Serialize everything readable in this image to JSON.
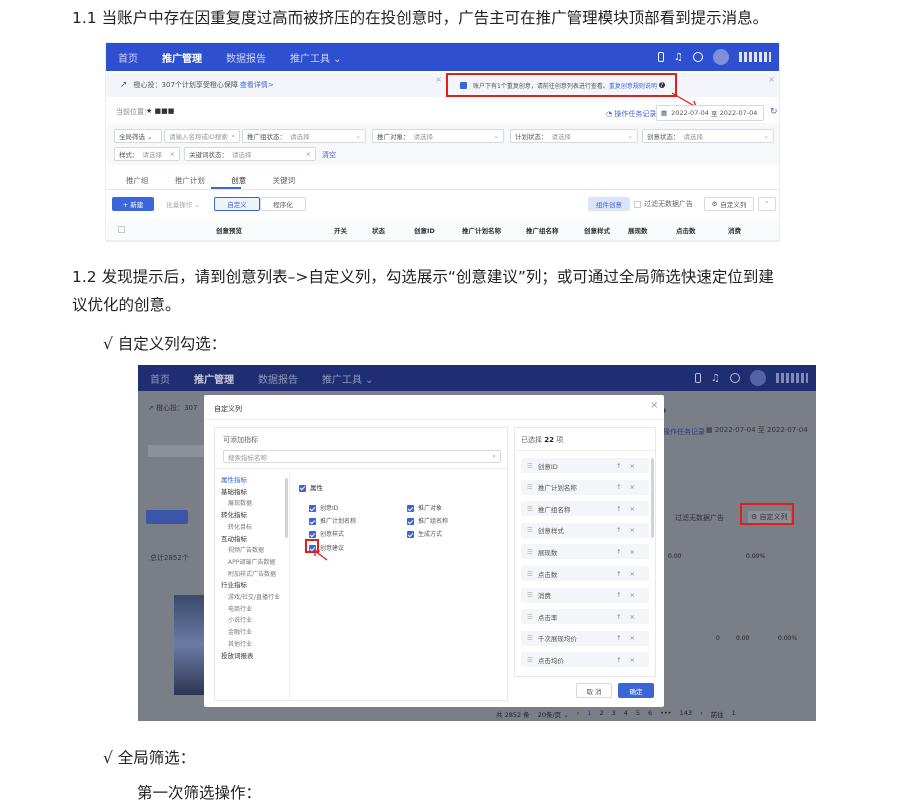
{
  "doc": {
    "para1": "1.1 当账户中存在因重复度过高而被挤压的在投创意时，广告主可在推广管理模块顶部看到提示消息。",
    "para2_line1": "1.2 发现提示后，请到创意列表–>自定义列，勾选展示“创意建议”列；或可通过全局筛选快速定位到建",
    "para2_line2": "议优化的创意。",
    "bullet1": "√ 自定义列勾选：",
    "bullet2": "√ 全局筛选：",
    "sub1": "第一次筛选操作："
  },
  "shot1": {
    "nav": [
      "首页",
      "推广管理",
      "数据报告",
      "推广工具 ⌄"
    ],
    "notice_left": "橙心投：307个计划享受橙心保障",
    "notice_left_link": "查看详情>",
    "notice_right": "账户下有1个重复创意，请前往创意列表进行查看。",
    "notice_right_link": "重复创意规则说明",
    "location_label": "当前位置：",
    "location_value": "★ ■■■",
    "ops_record": "操作任务记录",
    "date_from": "2022-07-04",
    "date_sep": "至",
    "date_to": "2022-07-04",
    "filter_global": "全局筛选 ⌄",
    "filter_search_ph": "请输入名称或ID搜索",
    "filters": [
      {
        "label": "推广组状态：",
        "ph": "请选择"
      },
      {
        "label": "推广对象：",
        "ph": "请选择"
      },
      {
        "label": "计划状态：",
        "ph": "请选择"
      },
      {
        "label": "创意状态：",
        "ph": "请选择"
      },
      {
        "label": "样式：",
        "ph": "请选择"
      },
      {
        "label": "关键词状态：",
        "ph": "请选择"
      }
    ],
    "clear": "清空",
    "tabs": [
      "推广组",
      "推广计划",
      "创意",
      "关键词"
    ],
    "btn_new": "+ 新建",
    "btn_batch": "批量操作 ⌄",
    "btn_custom": "自定义",
    "btn_program": "程序化",
    "btn_component": "组件创意",
    "filter_nodata": "过滤无数据广告",
    "btn_custom_col": "自定义列",
    "columns": [
      "创意预览",
      "开关",
      "状态",
      "创意ID",
      "推广计划名称",
      "推广组名称",
      "创意样式",
      "展现数",
      "点击数",
      "消费"
    ]
  },
  "shot2": {
    "nav": [
      "首页",
      "推广管理",
      "数据报告",
      "推广工具 ⌄"
    ],
    "modal_title": "自定义列",
    "left_header": "可添加指标",
    "search_ph": "搜索指标名称",
    "categories": [
      {
        "text": "属性指标",
        "type": "cat-active"
      },
      {
        "text": "基础指标",
        "type": "cat"
      },
      {
        "text": "展现数据",
        "type": "sub"
      },
      {
        "text": "转化指标",
        "type": "cat"
      },
      {
        "text": "转化目标",
        "type": "sub"
      },
      {
        "text": "互动指标",
        "type": "cat"
      },
      {
        "text": "视频广告数据",
        "type": "sub"
      },
      {
        "text": "APP调端广告数据",
        "type": "sub"
      },
      {
        "text": "附加样式广告数据",
        "type": "sub"
      },
      {
        "text": "行业指标",
        "type": "cat"
      },
      {
        "text": "游戏/社交/直播行业",
        "type": "sub"
      },
      {
        "text": "电商行业",
        "type": "sub"
      },
      {
        "text": "小说行业",
        "type": "sub"
      },
      {
        "text": "金融行业",
        "type": "sub"
      },
      {
        "text": "其他行业",
        "type": "sub"
      },
      {
        "text": "投放词报表",
        "type": "cat"
      }
    ],
    "attr_group": "属性",
    "checkboxes": [
      "创意ID",
      "推广对象",
      "推广计划名称",
      "推广组名称",
      "创意样式",
      "生成方式",
      "创意建议"
    ],
    "selected_label": "已选择",
    "selected_count": "22",
    "selected_unit": "项",
    "selected_items": [
      "创意ID",
      "推广计划名称",
      "推广组名称",
      "创意样式",
      "展现数",
      "点击数",
      "消费",
      "点击率",
      "千次展现均价",
      "点击均价"
    ],
    "btn_cancel": "取 消",
    "btn_ok": "确定",
    "date_from": "2022-07-04",
    "date_sep": "至",
    "date_to": "2022-07-04",
    "bg_custom_col": "自定义列",
    "bg_filter_nodata": "过滤无数据广告",
    "bg_total": "总计2852个",
    "bg_notice": "橙心投：307",
    "bg_values": [
      "0.00",
      "0.00%",
      "0",
      "0.00",
      "0.00%"
    ],
    "pagination": [
      "共 2852 条",
      "20条/页 ⌄",
      "1",
      "2",
      "3",
      "4",
      "5",
      "6",
      "•••",
      "143",
      "前往",
      "1"
    ]
  }
}
